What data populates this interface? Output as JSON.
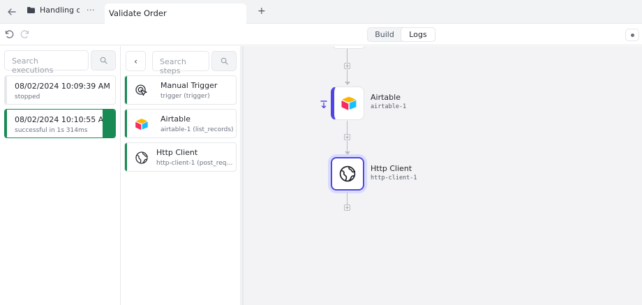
{
  "tabs": {
    "workflow_tab": "Handling o",
    "current_tab": "Validate Order",
    "more": "···",
    "new_tab": "+"
  },
  "toolbar": {
    "build_label": "Build",
    "logs_label": "Logs"
  },
  "executions": {
    "search_placeholder": "Search executions",
    "items": [
      {
        "time": "08/02/2024 10:09:39 AM",
        "status": "stopped"
      },
      {
        "time": "08/02/2024 10:10:55 A...",
        "status": "successful in 1s 314ms"
      }
    ]
  },
  "steps": {
    "collapse": "‹",
    "search_placeholder": "Search steps",
    "items": [
      {
        "name": "Manual Trigger",
        "detail": "trigger (trigger)",
        "icon": "cursor-click-icon"
      },
      {
        "name": "Airtable",
        "detail": "airtable-1 (list_records)",
        "icon": "airtable-icon"
      },
      {
        "name": "Http Client",
        "detail": "http-client-1 (post_request)",
        "icon": "globe-icon"
      }
    ]
  },
  "canvas": {
    "nodes": [
      {
        "name": "Airtable",
        "id": "airtable-1"
      },
      {
        "name": "Http Client",
        "id": "http-client-1"
      }
    ]
  },
  "colors": {
    "success": "#1a8a55",
    "accent": "#4f46e5"
  }
}
